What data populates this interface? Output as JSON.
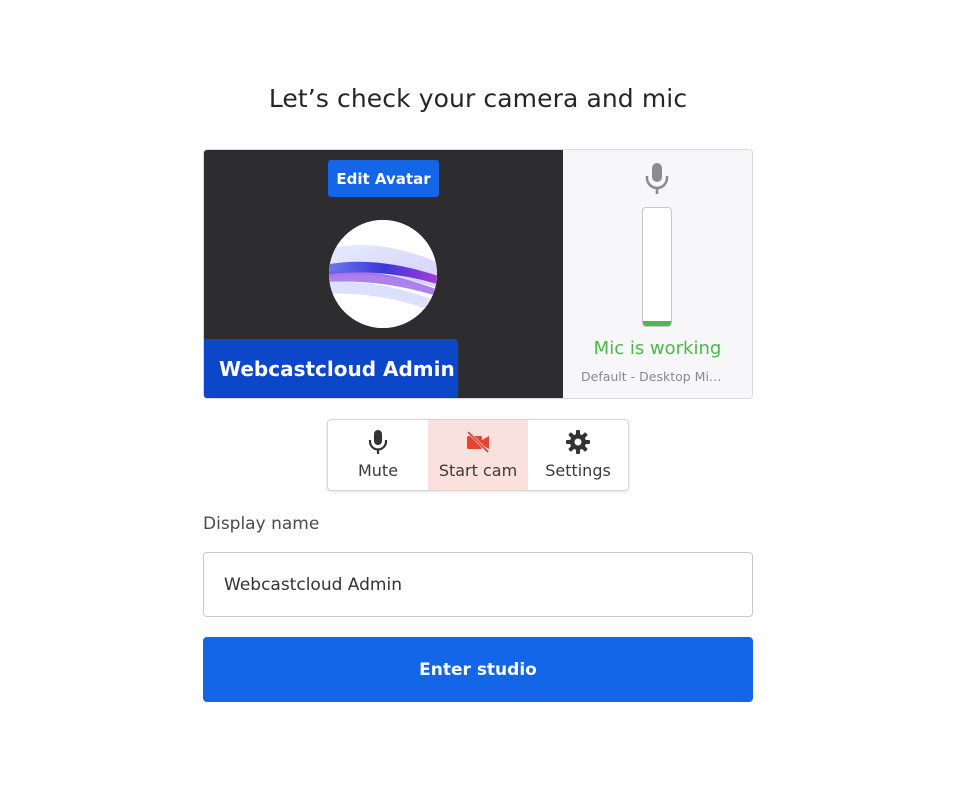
{
  "page": {
    "title": "Let’s check your camera and mic"
  },
  "preview": {
    "edit_avatar_label": "Edit Avatar",
    "participant_name": "Webcastcloud Admin",
    "mic_status": "Mic is working",
    "mic_device": "Default - Desktop Mi…",
    "mic_level_fraction": 0.04
  },
  "controls": {
    "mute_label": "Mute",
    "cam_label": "Start cam",
    "settings_label": "Settings",
    "mute_icon": "microphone-icon",
    "cam_icon": "camera-off-icon",
    "settings_icon": "gear-icon"
  },
  "form": {
    "display_name_label": "Display name",
    "display_name_value": "Webcastcloud Admin",
    "enter_label": "Enter studio"
  },
  "colors": {
    "accent": "#1466e8",
    "name_tag": "#0c47c9",
    "mic_ok": "#4cb849",
    "cam_off_bg": "#fbe1dd",
    "cam_off_icon": "#e8442f"
  }
}
